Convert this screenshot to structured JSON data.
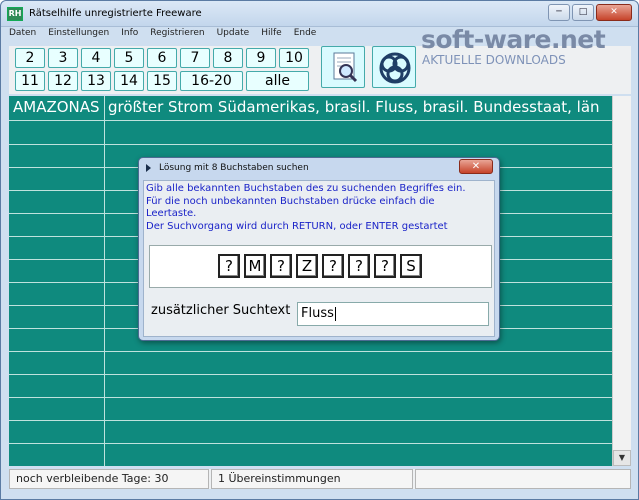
{
  "window": {
    "title": "Rätselhilfe unregistrierte Freeware",
    "controls": [
      "─",
      "□",
      "✕"
    ]
  },
  "menu": [
    "Daten",
    "Einstellungen",
    "Info",
    "Registrieren",
    "Update",
    "Hilfe",
    "Ende"
  ],
  "toolbar": {
    "row1": [
      "2",
      "3",
      "4",
      "5",
      "6",
      "7",
      "8",
      "9",
      "10"
    ],
    "row2": [
      "11",
      "12",
      "13",
      "14",
      "15",
      "16-20",
      "alle"
    ],
    "icons": [
      "search-document-icon",
      "knot-icon"
    ]
  },
  "watermark": {
    "logo": "soft-ware.net",
    "subtitle": "AKTUELLE DOWNLOADS"
  },
  "grid": {
    "first_row": {
      "word": "AMAZONAS",
      "description": "größter Strom Südamerikas, brasil. Fluss, brasil. Bundesstaat, län"
    },
    "colors": {
      "background": "#0f8a7e",
      "lines": "#bfe2dd"
    }
  },
  "statusbar": {
    "days_left": "noch verbleibende Tage: 30",
    "matches": "1 Übereinstimmungen",
    "empty": ""
  },
  "dialog": {
    "title": "Lösung mit 8 Buchstaben suchen",
    "close": "✕",
    "instructions": [
      "Gib alle bekannten Buchstaben des zu suchenden Begriffes ein.",
      "Für die noch unbekannten Buchstaben drücke einfach die",
      "Leertaste.",
      "Der Suchvorgang wird durch RETURN, oder ENTER gestartet"
    ],
    "letters": [
      "?",
      "M",
      "?",
      "Z",
      "?",
      "?",
      "?",
      "S"
    ],
    "extra_label": "zusätzlicher Suchtext",
    "extra_value": "Fluss"
  }
}
